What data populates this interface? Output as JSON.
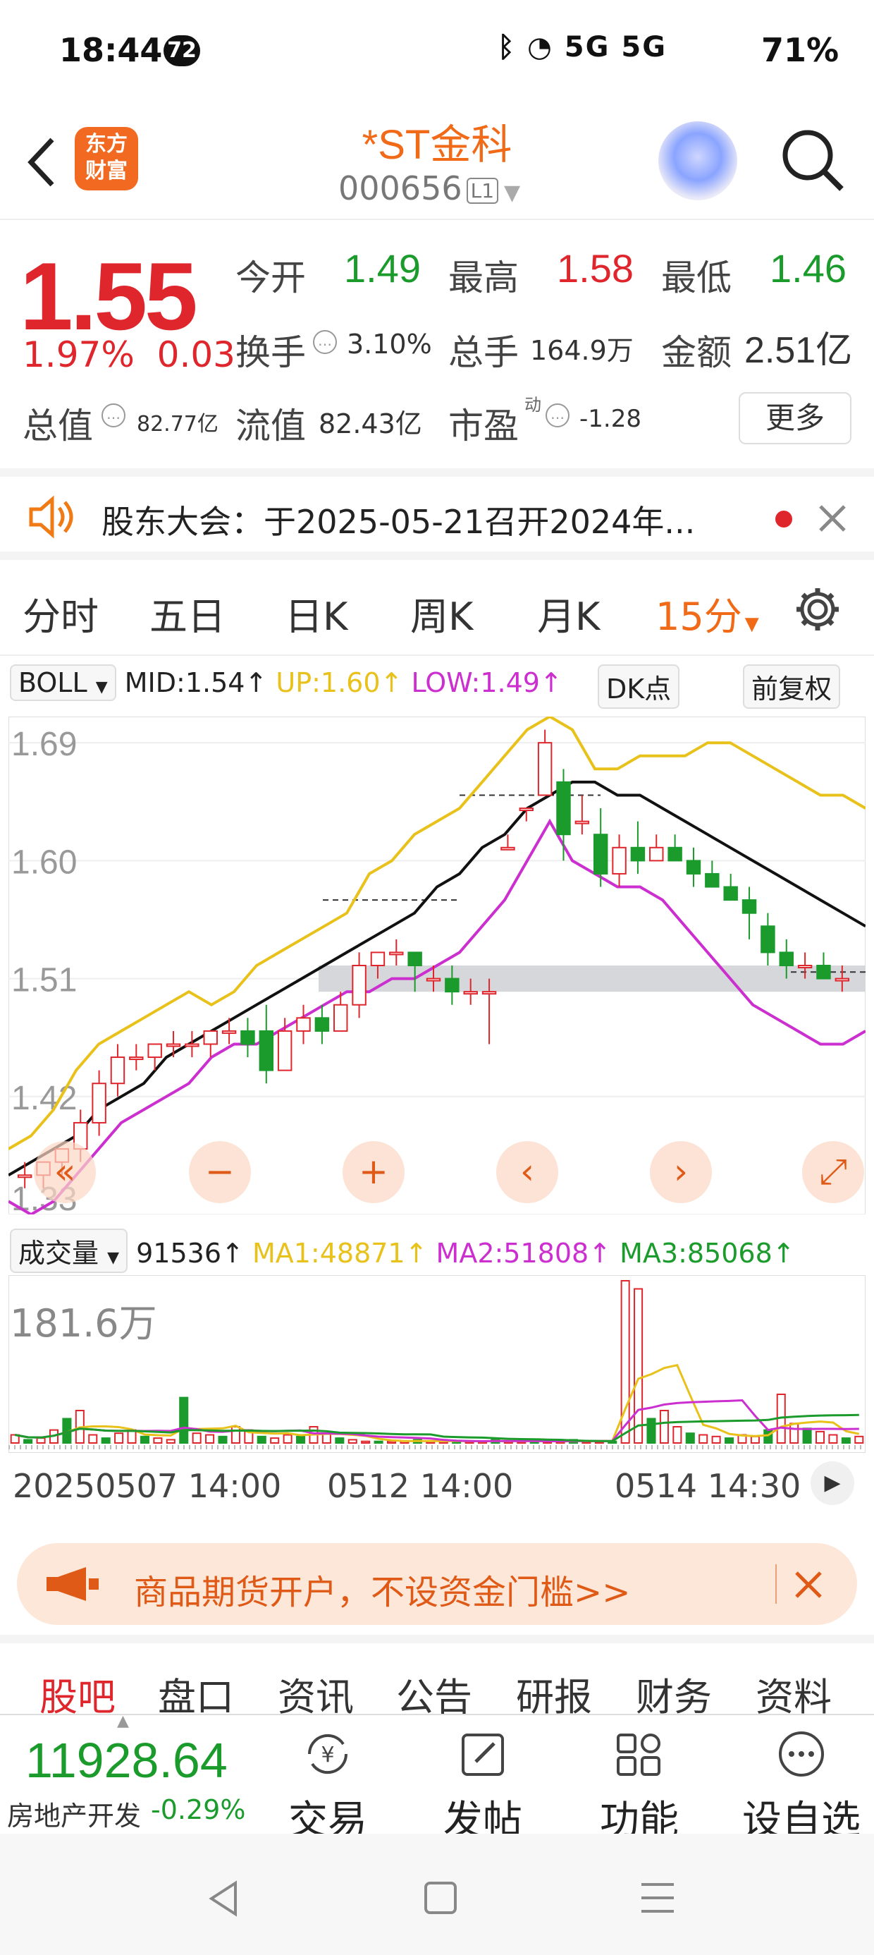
{
  "status_bar": {
    "time": "18:44",
    "notification_count": "72",
    "signal": "5G 5G",
    "battery": "71%"
  },
  "header": {
    "logo_line1": "东方",
    "logo_line2": "财富",
    "title": "*ST金科",
    "code": "000656",
    "level": "L1"
  },
  "quote": {
    "price": "1.55",
    "change_pct": "1.97%",
    "change_amt": "0.03",
    "open_label": "今开",
    "open": "1.49",
    "high_label": "最高",
    "high": "1.58",
    "low_label": "最低",
    "low": "1.46",
    "turnover_label": "换手",
    "turnover": "3.10%",
    "volume_label": "总手",
    "volume": "164.9万",
    "amount_label": "金额",
    "amount": "2.51亿",
    "mktcap_label": "总值",
    "mktcap": "82.77亿",
    "float_label": "流值",
    "float_cap": "82.43亿",
    "pe_label": "市盈",
    "pe_sup": "动",
    "pe": "-1.28",
    "more_label": "更多"
  },
  "notice": {
    "text": "股东大会：于2025-05-21召开2024年..."
  },
  "period_tabs": [
    "分时",
    "五日",
    "日K",
    "周K",
    "月K",
    "15分"
  ],
  "active_tab": "15分",
  "indicator": {
    "name": "BOLL",
    "mid": "MID:1.54↑",
    "up": "UP:1.60↑",
    "low": "LOW:1.49↑",
    "dk": "DK点",
    "adjust": "前复权"
  },
  "volume_indicator": {
    "name": "成交量",
    "vol": "91536↑",
    "ma1": "MA1:48871↑",
    "ma2": "MA2:51808↑",
    "ma3": "MA3:85068↑",
    "max_label": "181.6万"
  },
  "chart_data": {
    "type": "candlestick",
    "y_ticks": [
      "1.69",
      "1.60",
      "1.51",
      "1.42",
      "1.33"
    ],
    "ylim": [
      1.33,
      1.71
    ],
    "x_labels": [
      "20250507 14:00",
      "0512 14:00",
      "0514 14:30"
    ],
    "colors": {
      "up": "#e0262d",
      "down": "#1a9b2c",
      "boll_up": "#e8c11a",
      "boll_mid": "#111111",
      "boll_low": "#cc2fcf"
    },
    "candles": [
      [
        1.36,
        1.36,
        1.35,
        1.37
      ],
      [
        1.36,
        1.37,
        1.35,
        1.37
      ],
      [
        1.37,
        1.38,
        1.36,
        1.38
      ],
      [
        1.38,
        1.4,
        1.37,
        1.41
      ],
      [
        1.4,
        1.43,
        1.39,
        1.44
      ],
      [
        1.43,
        1.45,
        1.42,
        1.46
      ],
      [
        1.45,
        1.45,
        1.44,
        1.46
      ],
      [
        1.45,
        1.46,
        1.44,
        1.46
      ],
      [
        1.46,
        1.46,
        1.45,
        1.47
      ],
      [
        1.46,
        1.46,
        1.45,
        1.47
      ],
      [
        1.46,
        1.47,
        1.45,
        1.47
      ],
      [
        1.47,
        1.47,
        1.46,
        1.48
      ],
      [
        1.47,
        1.46,
        1.45,
        1.48
      ],
      [
        1.47,
        1.44,
        1.43,
        1.49
      ],
      [
        1.44,
        1.47,
        1.44,
        1.48
      ],
      [
        1.47,
        1.48,
        1.46,
        1.49
      ],
      [
        1.48,
        1.47,
        1.46,
        1.49
      ],
      [
        1.47,
        1.49,
        1.47,
        1.5
      ],
      [
        1.49,
        1.52,
        1.48,
        1.53
      ],
      [
        1.52,
        1.53,
        1.51,
        1.53
      ],
      [
        1.53,
        1.53,
        1.52,
        1.54
      ],
      [
        1.53,
        1.52,
        1.5,
        1.53
      ],
      [
        1.51,
        1.51,
        1.5,
        1.52
      ],
      [
        1.51,
        1.5,
        1.49,
        1.52
      ],
      [
        1.5,
        1.5,
        1.49,
        1.51
      ],
      [
        1.5,
        1.5,
        1.46,
        1.51
      ],
      [
        1.61,
        1.61,
        1.61,
        1.62
      ],
      [
        1.64,
        1.64,
        1.63,
        1.64
      ],
      [
        1.65,
        1.69,
        1.65,
        1.7
      ],
      [
        1.66,
        1.62,
        1.6,
        1.67
      ],
      [
        1.63,
        1.63,
        1.62,
        1.65
      ],
      [
        1.62,
        1.59,
        1.58,
        1.64
      ],
      [
        1.59,
        1.61,
        1.58,
        1.62
      ],
      [
        1.61,
        1.6,
        1.59,
        1.63
      ],
      [
        1.6,
        1.61,
        1.6,
        1.62
      ],
      [
        1.61,
        1.6,
        1.6,
        1.62
      ],
      [
        1.6,
        1.59,
        1.58,
        1.61
      ],
      [
        1.59,
        1.58,
        1.58,
        1.6
      ],
      [
        1.58,
        1.57,
        1.57,
        1.59
      ],
      [
        1.57,
        1.56,
        1.54,
        1.58
      ],
      [
        1.55,
        1.53,
        1.52,
        1.56
      ],
      [
        1.53,
        1.52,
        1.51,
        1.54
      ],
      [
        1.52,
        1.52,
        1.51,
        1.53
      ],
      [
        1.52,
        1.51,
        1.51,
        1.53
      ],
      [
        1.51,
        1.51,
        1.5,
        1.52
      ]
    ],
    "boll_up": [
      1.38,
      1.39,
      1.41,
      1.44,
      1.46,
      1.47,
      1.48,
      1.49,
      1.5,
      1.49,
      1.5,
      1.52,
      1.53,
      1.54,
      1.55,
      1.56,
      1.59,
      1.6,
      1.62,
      1.63,
      1.64,
      1.66,
      1.68,
      1.7,
      1.71,
      1.7,
      1.67,
      1.67,
      1.68,
      1.68,
      1.68,
      1.69,
      1.69,
      1.68,
      1.67,
      1.66,
      1.65,
      1.65,
      1.64
    ],
    "boll_mid": [
      1.36,
      1.37,
      1.38,
      1.39,
      1.41,
      1.42,
      1.43,
      1.45,
      1.46,
      1.47,
      1.48,
      1.49,
      1.5,
      1.51,
      1.52,
      1.53,
      1.54,
      1.55,
      1.56,
      1.58,
      1.59,
      1.61,
      1.62,
      1.64,
      1.65,
      1.66,
      1.66,
      1.65,
      1.65,
      1.64,
      1.63,
      1.62,
      1.61,
      1.6,
      1.59,
      1.58,
      1.57,
      1.56,
      1.55
    ],
    "boll_low": [
      1.34,
      1.33,
      1.34,
      1.36,
      1.38,
      1.4,
      1.41,
      1.42,
      1.43,
      1.45,
      1.46,
      1.46,
      1.47,
      1.48,
      1.49,
      1.5,
      1.5,
      1.51,
      1.51,
      1.52,
      1.53,
      1.55,
      1.57,
      1.6,
      1.63,
      1.6,
      1.59,
      1.58,
      1.58,
      1.57,
      1.55,
      1.53,
      1.51,
      1.49,
      1.48,
      1.47,
      1.46,
      1.46,
      1.47
    ],
    "volumes": [
      0.05,
      0.02,
      0.03,
      0.08,
      0.15,
      0.2,
      0.05,
      0.03,
      0.06,
      0.08,
      0.04,
      0.03,
      0.02,
      0.28,
      0.06,
      0.05,
      0.04,
      0.1,
      0.08,
      0.04,
      0.03,
      0.05,
      0.04,
      0.1,
      0.06,
      0.03,
      0.02,
      0.01,
      0.01,
      0.01,
      0.01,
      0.02,
      0.01,
      0.01,
      0.01,
      0.01,
      0.01,
      0.02,
      0.01,
      0.01,
      0.01,
      0.01,
      0.01,
      0.02,
      0.01,
      0.01,
      0.01,
      1.0,
      0.95,
      0.15,
      0.2,
      0.1,
      0.06,
      0.05,
      0.04,
      0.03,
      0.05,
      0.04,
      0.08,
      0.3,
      0.12,
      0.09,
      0.07,
      0.05,
      0.03,
      0.04
    ]
  },
  "ad": {
    "text": "商品期货开户，不设资金门槛>>"
  },
  "bottom_tabs": [
    "股吧",
    "盘口",
    "资讯",
    "公告",
    "研报",
    "财务",
    "资料"
  ],
  "footer": {
    "index_value": "11928.64",
    "index_name": "房地产开发",
    "index_change": "-0.29%",
    "trade": "交易",
    "post": "发帖",
    "function": "功能",
    "watchlist": "设自选"
  }
}
